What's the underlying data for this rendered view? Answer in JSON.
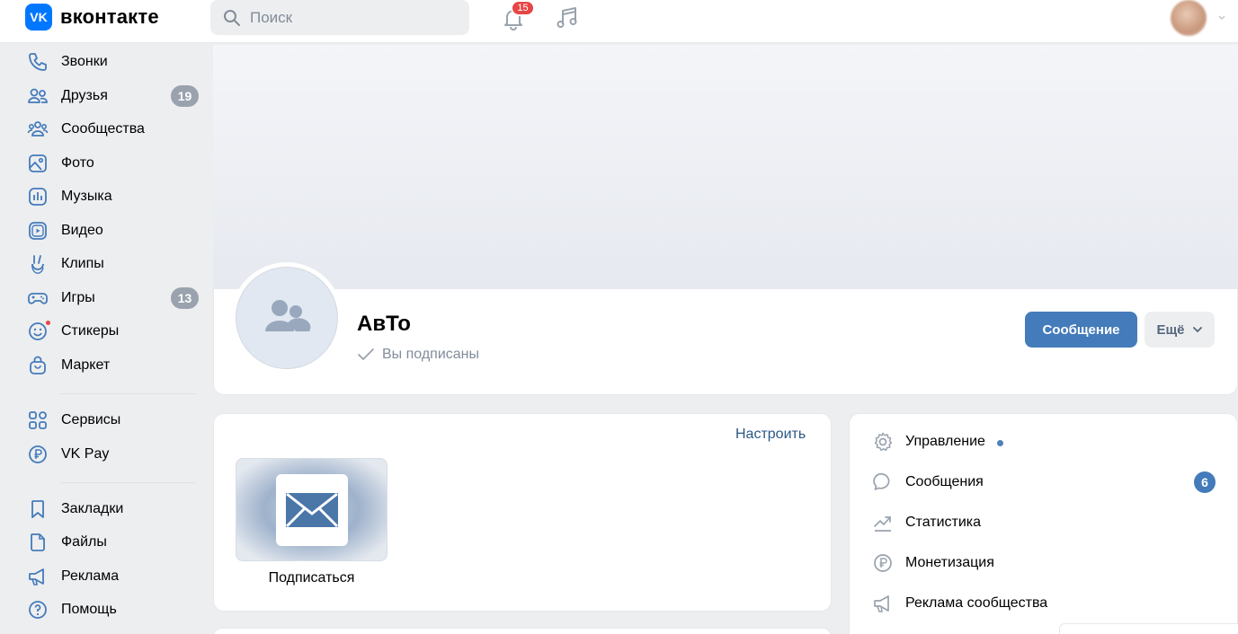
{
  "header": {
    "logo_mark": "VK",
    "logo_text": "вконтакте",
    "search_placeholder": "Поиск",
    "notifications_count": "15"
  },
  "sidebar": {
    "items": [
      {
        "label": "Звонки",
        "icon": "phone-icon"
      },
      {
        "label": "Друзья",
        "icon": "friends-icon",
        "badge": "19"
      },
      {
        "label": "Сообщества",
        "icon": "communities-icon"
      },
      {
        "label": "Фото",
        "icon": "photo-icon"
      },
      {
        "label": "Музыка",
        "icon": "music-icon"
      },
      {
        "label": "Видео",
        "icon": "video-icon"
      },
      {
        "label": "Клипы",
        "icon": "clips-icon"
      },
      {
        "label": "Игры",
        "icon": "games-icon",
        "badge": "13"
      },
      {
        "label": "Стикеры",
        "icon": "stickers-icon"
      },
      {
        "label": "Маркет",
        "icon": "market-icon"
      },
      {
        "label": "Сервисы",
        "icon": "services-icon"
      },
      {
        "label": "VK Pay",
        "icon": "vkpay-icon"
      },
      {
        "label": "Закладки",
        "icon": "bookmark-icon"
      },
      {
        "label": "Файлы",
        "icon": "file-icon"
      },
      {
        "label": "Реклама",
        "icon": "megaphone-icon"
      },
      {
        "label": "Помощь",
        "icon": "help-icon"
      }
    ]
  },
  "group": {
    "name": "АвТо",
    "subscribed_status": "Вы подписаны",
    "message_button": "Сообщение",
    "more_button": "Ещё"
  },
  "content": {
    "configure_link": "Настроить",
    "subscribe_label": "Подписаться"
  },
  "manage": {
    "items": [
      {
        "label": "Управление",
        "icon": "gear-icon"
      },
      {
        "label": "Сообщения",
        "icon": "chat-icon",
        "badge": "6"
      },
      {
        "label": "Статистика",
        "icon": "stats-icon"
      },
      {
        "label": "Монетизация",
        "icon": "ruble-icon"
      },
      {
        "label": "Реклама сообщества",
        "icon": "megaphone-icon"
      }
    ]
  },
  "colors": {
    "brand": "#0077ff",
    "primary_button": "#447bba",
    "link": "#2a5885",
    "badge_red": "#e64646",
    "badge_gray": "#99a2ad"
  }
}
